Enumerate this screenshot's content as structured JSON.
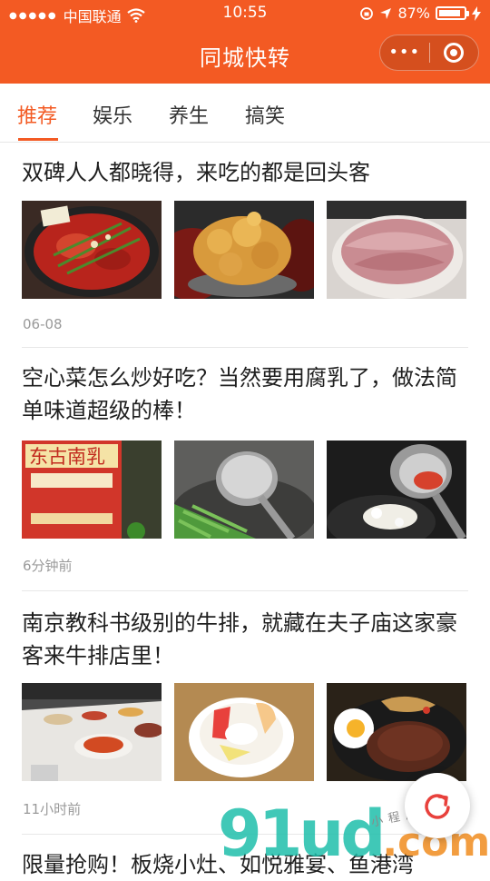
{
  "status_bar": {
    "carrier": "中国联通",
    "time": "10:55",
    "battery_percent": "87%",
    "battery_level": 0.87
  },
  "header": {
    "title": "同城快转",
    "more_glyph": "•••"
  },
  "tabs": [
    {
      "label": "推荐",
      "active": true
    },
    {
      "label": "娱乐",
      "active": false
    },
    {
      "label": "养生",
      "active": false
    },
    {
      "label": "搞笑",
      "active": false
    }
  ],
  "articles": [
    {
      "title": "双碑人人都晓得，来吃的都是回头客",
      "time": "06-08",
      "images": [
        "spicy-hotpot-photo",
        "fried-chicken-photo",
        "raw-meat-slices-photo"
      ]
    },
    {
      "title": "空心菜怎么炒好吃？当然要用腐乳了，做法简单味道超级的棒！",
      "time": "6分钟前",
      "images": [
        "fermented-tofu-jar-photo",
        "ladle-over-greens-photo",
        "ladle-in-wok-photo"
      ]
    },
    {
      "title": "南京教科书级别的牛排，就藏在夫子庙这家豪客来牛排店里！",
      "time": "11小时前",
      "images": [
        "buffet-counter-photo",
        "fruit-salad-bowl-photo",
        "steak-plate-photo"
      ]
    },
    {
      "title": "限量抢购！板烧小灶、如悦雅宴、鱼港湾",
      "time": "",
      "images": []
    }
  ],
  "watermark": {
    "brand": "91ud",
    "suffix": ".com",
    "sub": "小程序商店"
  },
  "colors": {
    "accent": "#f35a23",
    "text": "#1f1f1f",
    "muted": "#9a9a9a"
  }
}
